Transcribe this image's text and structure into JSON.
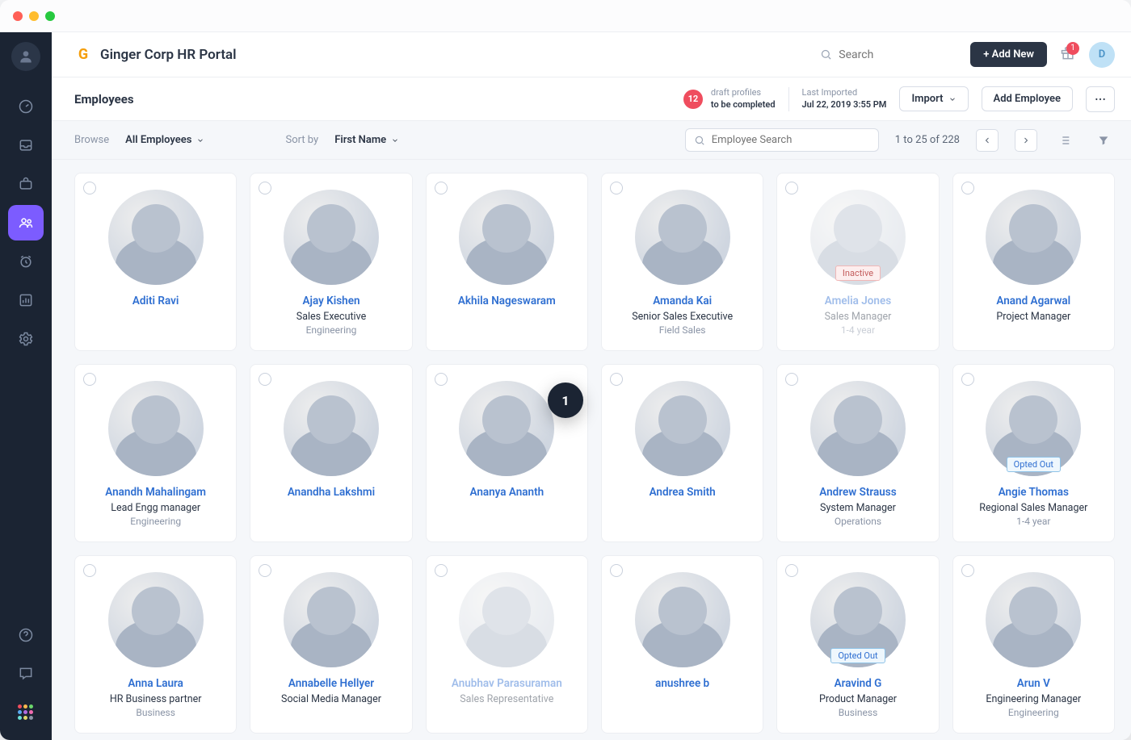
{
  "brand": {
    "logo_letter": "G",
    "title": "Ginger Corp HR Portal"
  },
  "topbar": {
    "search_placeholder": "Search",
    "add_new_label": "+ Add New",
    "gift_badge": "1",
    "avatar_letter": "D"
  },
  "subbar": {
    "page_title": "Employees",
    "draft_count": "12",
    "draft_line1": "draft profiles",
    "draft_line2": "to be completed",
    "last_imported_label": "Last Imported",
    "last_imported_value": "Jul 22, 2019 3:55 PM",
    "import_label": "Import",
    "add_employee_label": "Add Employee"
  },
  "filterbar": {
    "browse_label": "Browse",
    "browse_value": "All Employees",
    "sort_label": "Sort by",
    "sort_value": "First Name",
    "employee_search_placeholder": "Employee Search",
    "pager_text": "1 to 25 of 228"
  },
  "center_bubble": "1",
  "employees": [
    {
      "name": "Aditi Ravi",
      "role": "",
      "dept": ""
    },
    {
      "name": "Ajay Kishen",
      "role": "Sales Executive",
      "dept": "Engineering"
    },
    {
      "name": "Akhila Nageswaram",
      "role": "",
      "dept": ""
    },
    {
      "name": "Amanda Kai",
      "role": "Senior Sales Executive",
      "dept": "Field Sales"
    },
    {
      "name": "Amelia Jones",
      "role": "Sales Manager",
      "dept": "1-4 year",
      "dim": true,
      "tag": "Inactive",
      "tag_class": "tag-inactive"
    },
    {
      "name": "Anand Agarwal",
      "role": "Project Manager",
      "dept": ""
    },
    {
      "name": "Anandh Mahalingam",
      "role": "Lead Engg manager",
      "dept": "Engineering"
    },
    {
      "name": "Anandha Lakshmi",
      "role": "",
      "dept": ""
    },
    {
      "name": "Ananya Ananth",
      "role": "",
      "dept": ""
    },
    {
      "name": "Andrea Smith",
      "role": "",
      "dept": ""
    },
    {
      "name": "Andrew Strauss",
      "role": "System Manager",
      "dept": "Operations"
    },
    {
      "name": "Angie Thomas",
      "role": "Regional Sales Manager",
      "dept": "1-4 year",
      "tag": "Opted Out"
    },
    {
      "name": "Anna Laura",
      "role": "HR Business partner",
      "dept": "Business"
    },
    {
      "name": "Annabelle Hellyer",
      "role": "Social Media Manager",
      "dept": ""
    },
    {
      "name": "Anubhav Parasuraman",
      "role": "Sales Representative",
      "dept": "",
      "dim": true
    },
    {
      "name": "anushree b",
      "role": "",
      "dept": ""
    },
    {
      "name": "Aravind G",
      "role": "Product Manager",
      "dept": "Business",
      "tag": "Opted Out"
    },
    {
      "name": "Arun V",
      "role": "Engineering Manager",
      "dept": "Engineering"
    }
  ]
}
